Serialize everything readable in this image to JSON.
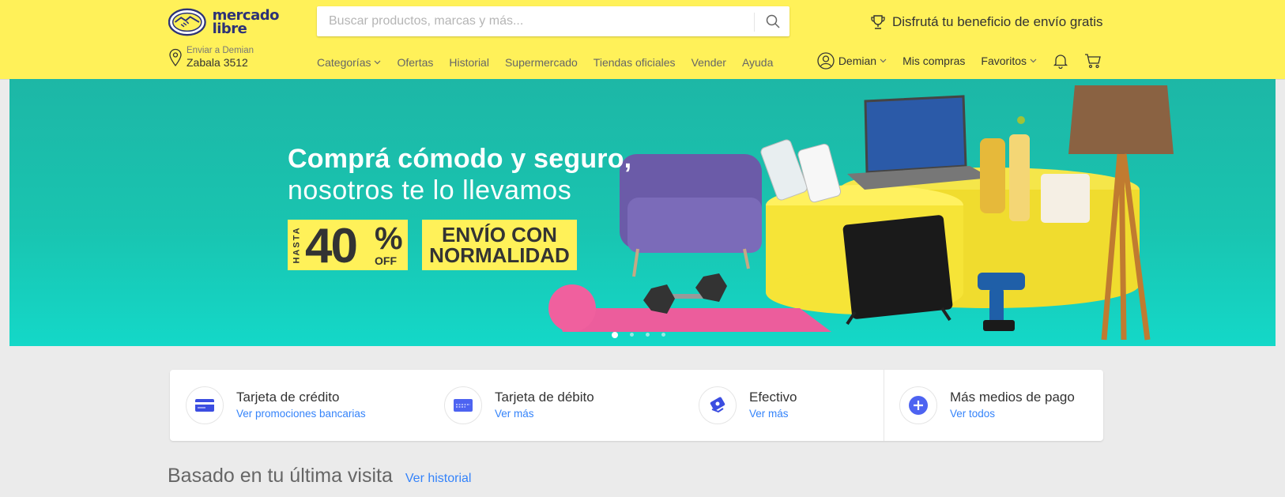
{
  "header": {
    "logo_line1": "mercado",
    "logo_line2": "libre",
    "search_placeholder": "Buscar productos, marcas y más...",
    "promo_text": "Disfrutá tu beneficio de envío gratis",
    "location_label": "Enviar a Demian",
    "location_address": "Zabala 3512",
    "nav": [
      "Categorías",
      "Ofertas",
      "Historial",
      "Supermercado",
      "Tiendas oficiales",
      "Vender",
      "Ayuda"
    ],
    "user_name": "Demian",
    "my_purchases": "Mis compras",
    "favorites": "Favoritos",
    "icons": [
      "location-pin-icon",
      "search-icon",
      "trophy-icon",
      "user-icon",
      "bell-icon",
      "cart-icon"
    ]
  },
  "banner": {
    "title_line1": "Comprá cómodo y seguro,",
    "title_line2": "nosotros te lo llevamos",
    "discount_prefix": "HASTA",
    "discount_value": "40",
    "discount_pct": "%",
    "discount_suffix": "OFF",
    "shipping_line1": "ENVÍO CON",
    "shipping_line2": "NORMALIDAD",
    "slides_count": 4,
    "active_slide": 1,
    "colors": {
      "bg": "#1db7a6",
      "badge": "#fff159"
    }
  },
  "payments": [
    {
      "title": "Tarjeta de crédito",
      "link": "Ver promociones bancarias",
      "icon": "credit-card-icon"
    },
    {
      "title": "Tarjeta de débito",
      "link": "Ver más",
      "icon": "debit-card-icon"
    },
    {
      "title": "Efectivo",
      "link": "Ver más",
      "icon": "cash-icon"
    },
    {
      "title": "Más medios de pago",
      "link": "Ver todos",
      "icon": "plus-icon"
    }
  ],
  "section": {
    "title": "Basado en tu última visita",
    "link": "Ver historial"
  },
  "colors": {
    "header_bg": "#fff159",
    "link": "#3483fa",
    "accent": "#2d3277",
    "page_bg": "#ebebeb"
  }
}
